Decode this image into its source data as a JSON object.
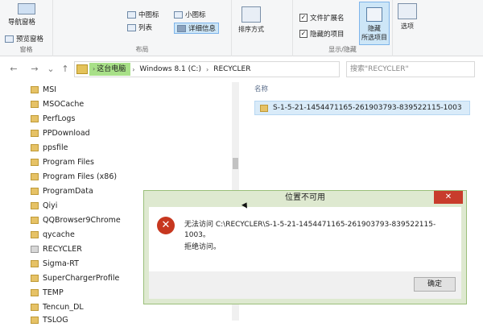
{
  "ribbon": {
    "nav_pane": "导航窗格",
    "preview_pane": "预览窗格",
    "group_pane": "窗格",
    "medium_icons": "中图标",
    "small_icons": "小图标",
    "list": "列表",
    "details": "详细信息",
    "group_layout": "布局",
    "sort_by": "排序方式",
    "file_ext": "文件扩展名",
    "hidden_items": "隐藏的项目",
    "hide_selected_line1": "隐藏",
    "hide_selected_line2": "所选项目",
    "group_show_hide": "显示/隐藏",
    "options": "选项"
  },
  "address": {
    "this_pc": "这台电脑",
    "drive": "Windows 8.1 (C:)",
    "folder": "RECYCLER",
    "search_placeholder": "搜索\"RECYCLER\""
  },
  "tree": {
    "items": [
      {
        "label": "MSI"
      },
      {
        "label": "MSOCache"
      },
      {
        "label": "PerfLogs"
      },
      {
        "label": "PPDownload"
      },
      {
        "label": "ppsfile"
      },
      {
        "label": "Program Files"
      },
      {
        "label": "Program Files (x86)"
      },
      {
        "label": "ProgramData"
      },
      {
        "label": "Qiyi"
      },
      {
        "label": "QQBrowser9Chrome"
      },
      {
        "label": "qycache"
      },
      {
        "label": "RECYCLER"
      },
      {
        "label": "Sigma-RT"
      },
      {
        "label": "SuperChargerProfile"
      },
      {
        "label": "TEMP"
      },
      {
        "label": "Tencun_DL"
      },
      {
        "label": "TSLOG"
      }
    ]
  },
  "content": {
    "column_name": "名称",
    "file": "S-1-5-21-1454471165-261903793-839522115-1003"
  },
  "dialog": {
    "title": "位置不可用",
    "close": "✕",
    "message": "无法访问 C:\\RECYCLER\\S-1-5-21-1454471165-261903793-839522115-1003。",
    "denied": "拒绝访问。",
    "ok": "确定"
  },
  "colors": {
    "dialog_frame": "#dee9d0",
    "close_button": "#c83c2c",
    "breadcrumb_highlight": "#a8e088",
    "selection": "#d9ebf9"
  }
}
